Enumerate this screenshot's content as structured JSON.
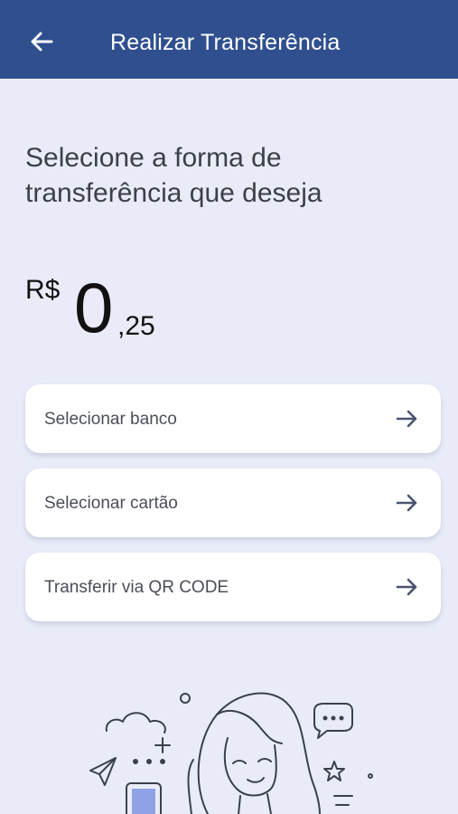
{
  "appbar": {
    "title": "Realizar Transferência",
    "back_icon": "arrow-left-icon"
  },
  "heading": "Selecione a forma de transferência que deseja",
  "amount": {
    "currency": "R$",
    "integer": "0",
    "decimal": ",25"
  },
  "options": [
    {
      "label": "Selecionar banco",
      "icon": "arrow-right-icon"
    },
    {
      "label": "Selecionar cartão",
      "icon": "arrow-right-icon"
    },
    {
      "label": "Transferir via QR CODE",
      "icon": "arrow-right-icon"
    }
  ],
  "colors": {
    "appbar": "#2f4f8f",
    "background": "#e9ecf8",
    "card": "#ffffff",
    "arrow": "#4a5270"
  }
}
